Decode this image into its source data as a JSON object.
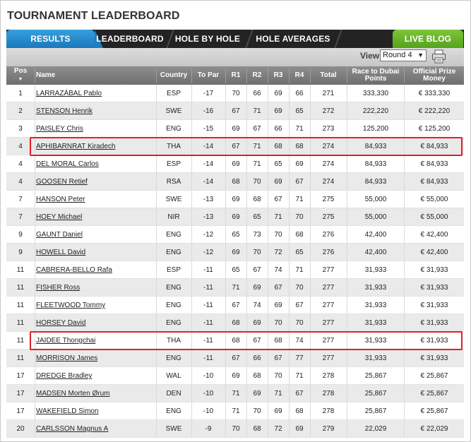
{
  "page": {
    "title": "TOURNAMENT LEADERBOARD"
  },
  "tabs": [
    {
      "label": "RESULTS",
      "active": true
    },
    {
      "label": "LEADERBOARD",
      "active": false
    },
    {
      "label": "HOLE BY HOLE",
      "active": false
    },
    {
      "label": "HOLE AVERAGES",
      "active": false
    }
  ],
  "live_blog": {
    "label": "LIVE BLOG"
  },
  "toolbar": {
    "view_label": "View",
    "round_value": "Round 4",
    "print_icon": "print-icon"
  },
  "columns": {
    "pos": "Pos",
    "name": "Name",
    "country": "Country",
    "to_par": "To Par",
    "r1": "R1",
    "r2": "R2",
    "r3": "R3",
    "r4": "R4",
    "total": "Total",
    "race": "Race to Dubai Points",
    "prize": "Official Prize Money"
  },
  "colors": {
    "accent": "#1f80c4",
    "live_blog": "#5fab23",
    "highlight": "#e0202a"
  },
  "rows": [
    {
      "pos": "1",
      "name": "LARRAZÁBAL Pablo",
      "country": "ESP",
      "to_par": "-17",
      "r1": "70",
      "r2": "66",
      "r3": "69",
      "r4": "66",
      "total": "271",
      "race": "333,330",
      "prize": "€ 333,330"
    },
    {
      "pos": "2",
      "name": "STENSON Henrik",
      "country": "SWE",
      "to_par": "-16",
      "r1": "67",
      "r2": "71",
      "r3": "69",
      "r4": "65",
      "total": "272",
      "race": "222,220",
      "prize": "€ 222,220"
    },
    {
      "pos": "3",
      "name": "PAISLEY Chris",
      "country": "ENG",
      "to_par": "-15",
      "r1": "69",
      "r2": "67",
      "r3": "66",
      "r4": "71",
      "total": "273",
      "race": "125,200",
      "prize": "€ 125,200"
    },
    {
      "pos": "4",
      "name": "APHIBARNRAT Kiradech",
      "country": "THA",
      "to_par": "-14",
      "r1": "67",
      "r2": "71",
      "r3": "68",
      "r4": "68",
      "total": "274",
      "race": "84,933",
      "prize": "€ 84,933"
    },
    {
      "pos": "4",
      "name": "DEL MORAL Carlos",
      "country": "ESP",
      "to_par": "-14",
      "r1": "69",
      "r2": "71",
      "r3": "65",
      "r4": "69",
      "total": "274",
      "race": "84,933",
      "prize": "€ 84,933"
    },
    {
      "pos": "4",
      "name": "GOOSEN Retief",
      "country": "RSA",
      "to_par": "-14",
      "r1": "68",
      "r2": "70",
      "r3": "69",
      "r4": "67",
      "total": "274",
      "race": "84,933",
      "prize": "€ 84,933"
    },
    {
      "pos": "7",
      "name": "HANSON Peter",
      "country": "SWE",
      "to_par": "-13",
      "r1": "69",
      "r2": "68",
      "r3": "67",
      "r4": "71",
      "total": "275",
      "race": "55,000",
      "prize": "€ 55,000"
    },
    {
      "pos": "7",
      "name": "HOEY Michael",
      "country": "NIR",
      "to_par": "-13",
      "r1": "69",
      "r2": "65",
      "r3": "71",
      "r4": "70",
      "total": "275",
      "race": "55,000",
      "prize": "€ 55,000"
    },
    {
      "pos": "9",
      "name": "GAUNT Daniel",
      "country": "ENG",
      "to_par": "-12",
      "r1": "65",
      "r2": "73",
      "r3": "70",
      "r4": "68",
      "total": "276",
      "race": "42,400",
      "prize": "€ 42,400"
    },
    {
      "pos": "9",
      "name": "HOWELL David",
      "country": "ENG",
      "to_par": "-12",
      "r1": "69",
      "r2": "70",
      "r3": "72",
      "r4": "65",
      "total": "276",
      "race": "42,400",
      "prize": "€ 42,400"
    },
    {
      "pos": "11",
      "name": "CABRERA-BELLO Rafa",
      "country": "ESP",
      "to_par": "-11",
      "r1": "65",
      "r2": "67",
      "r3": "74",
      "r4": "71",
      "total": "277",
      "race": "31,933",
      "prize": "€ 31,933"
    },
    {
      "pos": "11",
      "name": "FISHER Ross",
      "country": "ENG",
      "to_par": "-11",
      "r1": "71",
      "r2": "69",
      "r3": "67",
      "r4": "70",
      "total": "277",
      "race": "31,933",
      "prize": "€ 31,933"
    },
    {
      "pos": "11",
      "name": "FLEETWOOD Tommy",
      "country": "ENG",
      "to_par": "-11",
      "r1": "67",
      "r2": "74",
      "r3": "69",
      "r4": "67",
      "total": "277",
      "race": "31,933",
      "prize": "€ 31,933"
    },
    {
      "pos": "11",
      "name": "HORSEY David",
      "country": "ENG",
      "to_par": "-11",
      "r1": "68",
      "r2": "69",
      "r3": "70",
      "r4": "70",
      "total": "277",
      "race": "31,933",
      "prize": "€ 31,933"
    },
    {
      "pos": "11",
      "name": "JAIDEE Thongchai",
      "country": "THA",
      "to_par": "-11",
      "r1": "68",
      "r2": "67",
      "r3": "68",
      "r4": "74",
      "total": "277",
      "race": "31,933",
      "prize": "€ 31,933"
    },
    {
      "pos": "11",
      "name": "MORRISON James",
      "country": "ENG",
      "to_par": "-11",
      "r1": "67",
      "r2": "66",
      "r3": "67",
      "r4": "77",
      "total": "277",
      "race": "31,933",
      "prize": "€ 31,933"
    },
    {
      "pos": "17",
      "name": "DREDGE Bradley",
      "country": "WAL",
      "to_par": "-10",
      "r1": "69",
      "r2": "68",
      "r3": "70",
      "r4": "71",
      "total": "278",
      "race": "25,867",
      "prize": "€ 25,867"
    },
    {
      "pos": "17",
      "name": "MADSEN Morten Ørum",
      "country": "DEN",
      "to_par": "-10",
      "r1": "71",
      "r2": "69",
      "r3": "71",
      "r4": "67",
      "total": "278",
      "race": "25,867",
      "prize": "€ 25,867"
    },
    {
      "pos": "17",
      "name": "WAKEFIELD Simon",
      "country": "ENG",
      "to_par": "-10",
      "r1": "71",
      "r2": "70",
      "r3": "69",
      "r4": "68",
      "total": "278",
      "race": "25,867",
      "prize": "€ 25,867"
    },
    {
      "pos": "20",
      "name": "CARLSSON Magnus A",
      "country": "SWE",
      "to_par": "-9",
      "r1": "70",
      "r2": "68",
      "r3": "72",
      "r4": "69",
      "total": "279",
      "race": "22,029",
      "prize": "€ 22,029"
    }
  ],
  "highlighted_rows": [
    3,
    14
  ]
}
